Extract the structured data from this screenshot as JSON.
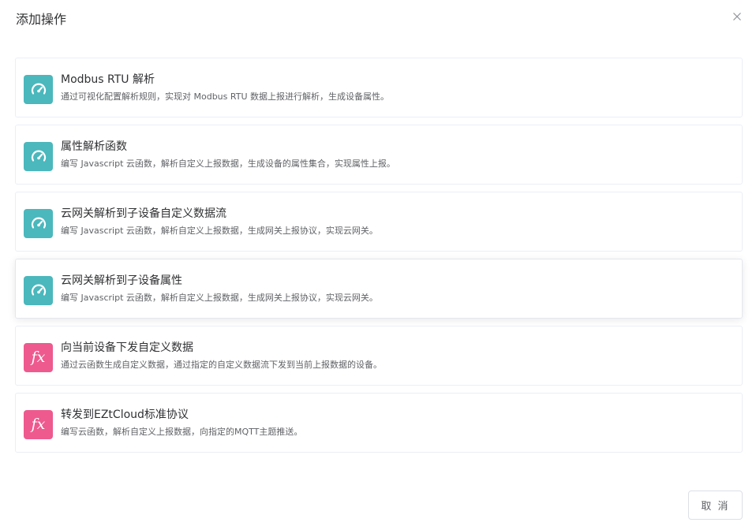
{
  "dialog": {
    "title": "添加操作",
    "close_icon": "close-icon",
    "cancel_label": "取 消"
  },
  "colors": {
    "teal_icon": "#4ab8bd",
    "pink_icon": "#ee5a8e",
    "card_border": "#ebeef5"
  },
  "actions": [
    {
      "icon": "gauge-icon",
      "fx_text": "",
      "title": "Modbus RTU 解析",
      "description": "通过可视化配置解析规则，实现对 Modbus RTU 数据上报进行解析，生成设备属性。"
    },
    {
      "icon": "gauge-icon",
      "fx_text": "",
      "title": "属性解析函数",
      "description": "编写 Javascript 云函数，解析自定义上报数据，生成设备的属性集合，实现属性上报。"
    },
    {
      "icon": "gauge-icon",
      "fx_text": "",
      "title": "云网关解析到子设备自定义数据流",
      "description": "编写 Javascript 云函数，解析自定义上报数据，生成网关上报协议，实现云网关。"
    },
    {
      "icon": "gauge-icon",
      "fx_text": "",
      "title": "云网关解析到子设备属性",
      "description": "编写 Javascript 云函数，解析自定义上报数据，生成网关上报协议，实现云网关。"
    },
    {
      "icon": "function-icon",
      "fx_text": "fx",
      "title": "向当前设备下发自定义数据",
      "description": "通过云函数生成自定义数据，通过指定的自定义数据流下发到当前上报数据的设备。"
    },
    {
      "icon": "function-icon",
      "fx_text": "fx",
      "title": "转发到EZtCloud标准协议",
      "description": "编写云函数，解析自定义上报数据，向指定的MQTT主题推送。"
    }
  ]
}
